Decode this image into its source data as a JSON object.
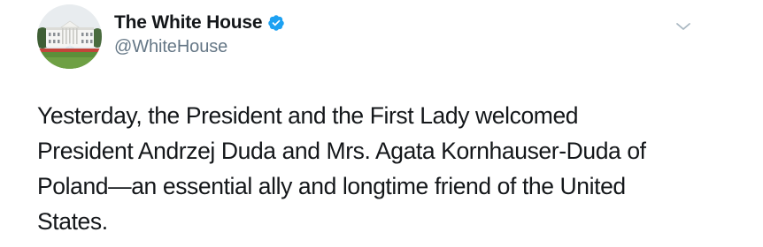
{
  "tweet": {
    "author": {
      "display_name": "The White House",
      "handle": "@WhiteHouse",
      "verified": true,
      "avatar_icon": "white-house-avatar-icon",
      "verified_icon": "verified-badge-icon"
    },
    "menu_icon": "chevron-down-icon",
    "text": "Yesterday, the President and the First Lady welcomed\nPresident Andrzej Duda and Mrs. Agata Kornhauser-Duda of\nPoland—an essential ally and longtime friend of the United\nStates."
  },
  "colors": {
    "text_primary": "#14171a",
    "text_secondary": "#657786",
    "verified_blue": "#1da1f2",
    "background": "#ffffff"
  }
}
